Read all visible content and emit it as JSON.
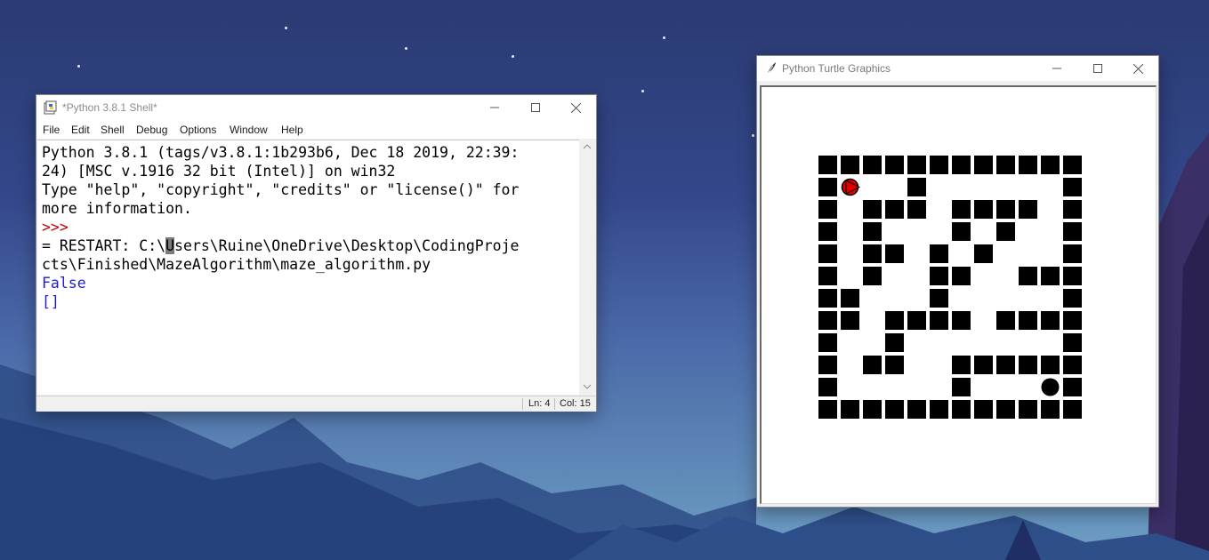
{
  "desktop": {
    "background_top": "#2a3a72",
    "background_bottom": "#6fa0c4"
  },
  "shell": {
    "title": "*Python 3.8.1 Shell*",
    "menu": [
      "File",
      "Edit",
      "Shell",
      "Debug",
      "Options",
      "Window",
      "Help"
    ],
    "lines": {
      "l1": "Python 3.8.1 (tags/v3.8.1:1b293b6, Dec 18 2019, 22:39:",
      "l2": "24) [MSC v.1916 32 bit (Intel)] on win32",
      "l3": "Type \"help\", \"copyright\", \"credits\" or \"license()\" for",
      "l4": "more information.",
      "prompt": ">>>",
      "restart_a": "= RESTART: C:\\",
      "restart_cursor": "U",
      "restart_b": "sers\\Ruine\\OneDrive\\Desktop\\CodingProje",
      "restart_c": "cts\\Finished\\MazeAlgorithm\\maze_algorithm.py",
      "out1": "False",
      "out2": "[]"
    },
    "status": {
      "line": "Ln: 4",
      "col": "Col: 15"
    },
    "icons": [
      "idle-icon",
      "minimize-icon",
      "maximize-icon",
      "close-icon"
    ]
  },
  "turtle": {
    "title": "Python Turtle Graphics",
    "icons": [
      "feather-icon",
      "minimize-icon",
      "maximize-icon",
      "close-icon"
    ],
    "maze": {
      "rows": [
        "############",
        "#T  #      #",
        "# ### ####.#",
        "# #   # # .#",
        "# ## # #   #",
        "# #  ##  ###",
        "##   #     #",
        "## #### ####",
        "#  #       #",
        "# ##  ######",
        "#     #   E#",
        "############"
      ],
      "wall_color": "#000000",
      "turtle_color": "#e00000",
      "end_marker": "black-circle"
    }
  }
}
